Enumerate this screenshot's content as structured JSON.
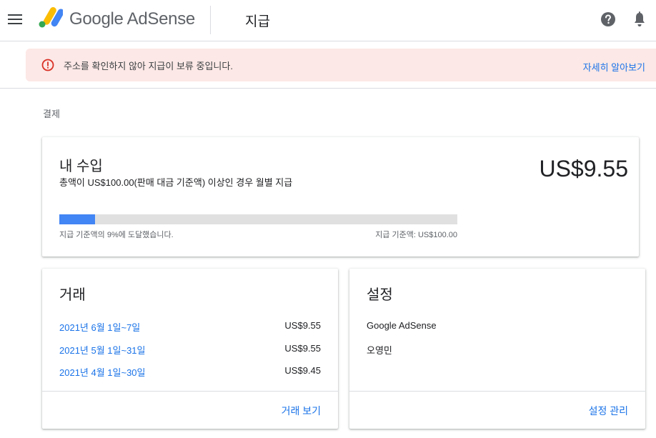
{
  "header": {
    "logo_text": "Google AdSense",
    "page_title": "지급",
    "icons": [
      "menu-icon",
      "help-icon",
      "notifications-icon"
    ]
  },
  "alert": {
    "message": "주소를 확인하지 않아 지급이 보류 중입니다.",
    "link": "자세히 알아보기",
    "icon": "error-icon",
    "color": "#d93025"
  },
  "breadcrumb": "결제",
  "earnings": {
    "title": "내 수입",
    "subtitle": "총액이 US$100.00(판매 대금 기준액) 이상인 경우 월별 지급",
    "amount": "US$9.55",
    "progress_percent": 9,
    "progress_left": "지급 기준액의 9%에 도달했습니다.",
    "progress_right": "지급 기준액: US$100.00"
  },
  "transactions": {
    "title": "거래",
    "rows": [
      {
        "date": "2021년 6월 1일~7일",
        "amount": "US$9.55"
      },
      {
        "date": "2021년 5월 1일~31일",
        "amount": "US$9.55"
      },
      {
        "date": "2021년 4월 1일~30일",
        "amount": "US$9.45"
      }
    ],
    "footer_link": "거래 보기"
  },
  "settings": {
    "title": "설정",
    "product": "Google AdSense",
    "name": "오영민",
    "footer_link": "설정 관리"
  },
  "colors": {
    "accent": "#1a73e8",
    "progress": "#4285f4",
    "alert_bg": "#fce8e6"
  }
}
